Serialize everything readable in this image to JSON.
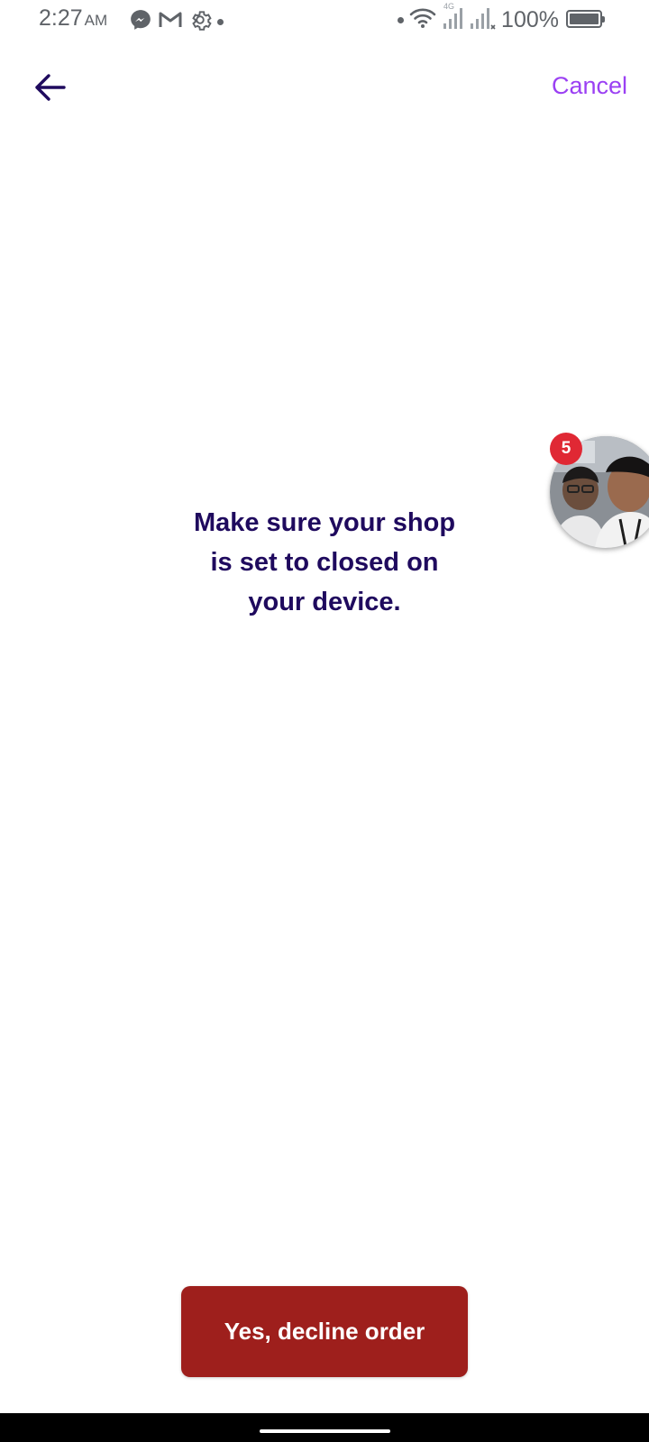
{
  "status_bar": {
    "time": "2:27",
    "ampm": "AM",
    "network_label": "4G",
    "battery_percent": "100%",
    "left_icons": [
      "messenger-icon",
      "gmail-icon",
      "settings-icon"
    ],
    "right_icons": [
      "wifi-icon",
      "signal-icon",
      "signal-icon"
    ]
  },
  "nav": {
    "back_icon": "arrow-left-icon",
    "cancel_label": "Cancel"
  },
  "main": {
    "message": "Make sure your shop is set to closed on your device."
  },
  "chat_head": {
    "badge_count": "5"
  },
  "actions": {
    "decline_label": "Yes, decline order"
  },
  "colors": {
    "accent": "#9b40f3",
    "heading": "#1f0a5e",
    "danger": "#9e1f1c",
    "badge": "#e02834"
  }
}
